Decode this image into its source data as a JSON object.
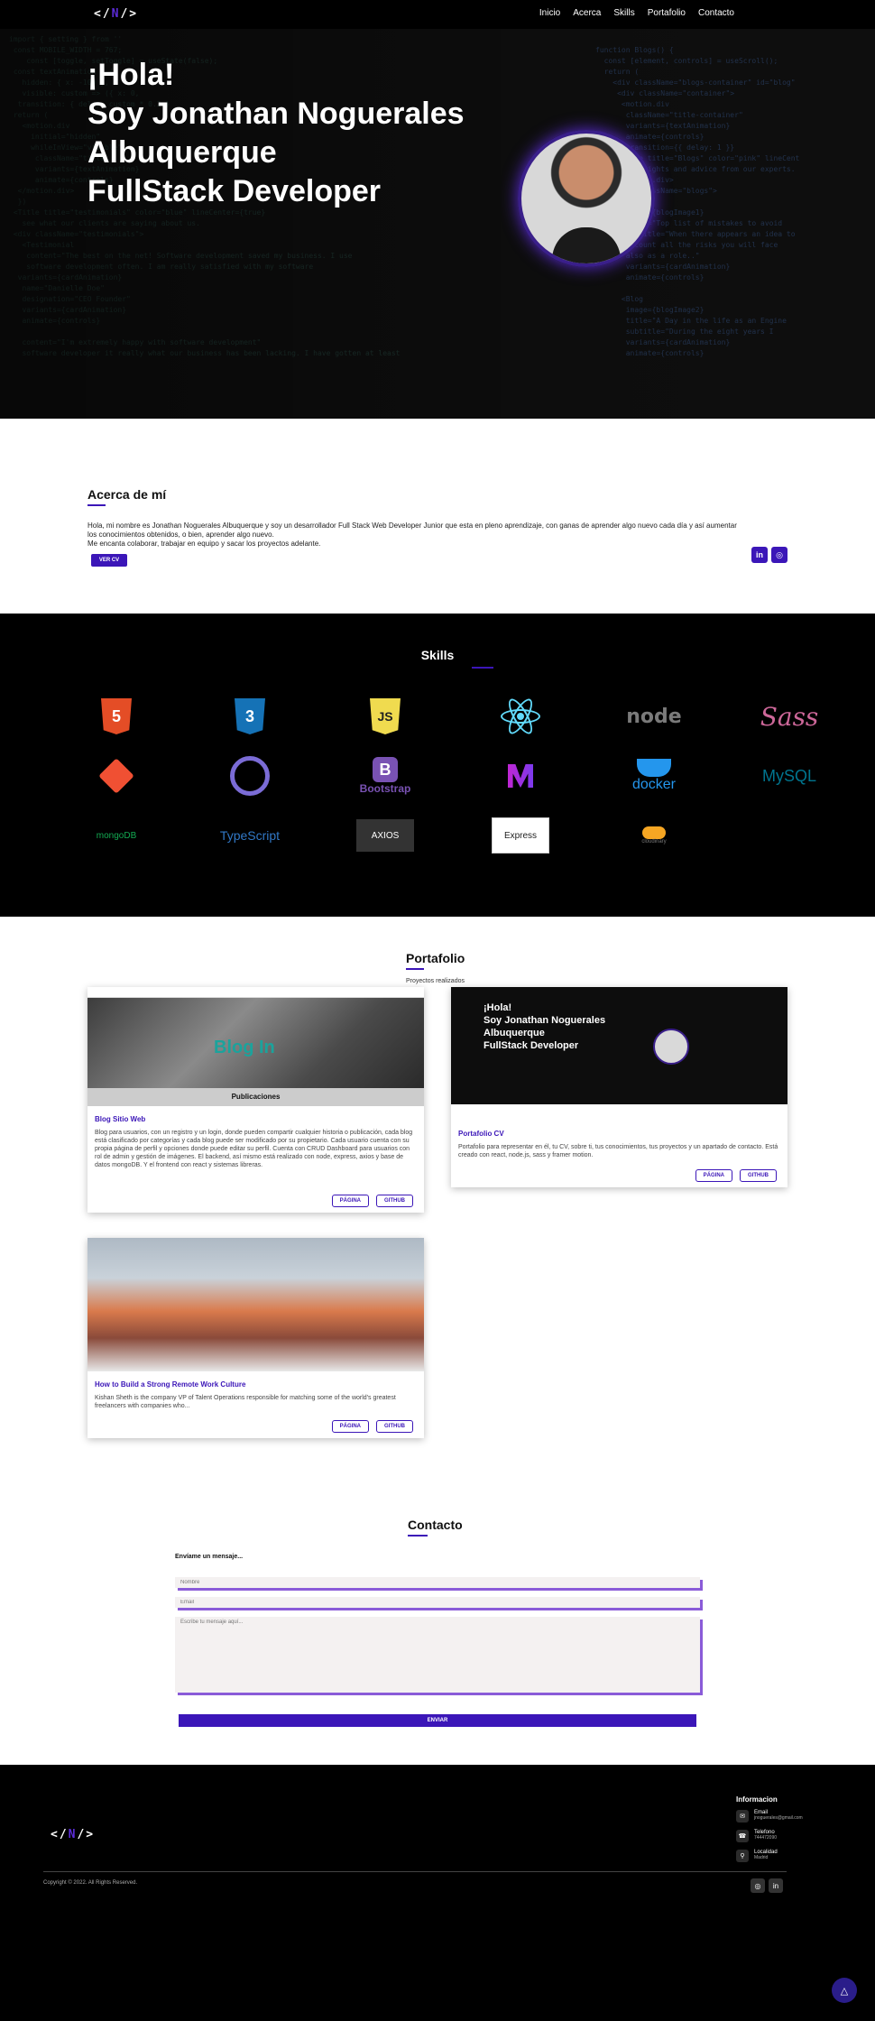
{
  "nav": {
    "logo": "</>",
    "links": [
      "Inicio",
      "Acerca",
      "Skills",
      "Portafolio",
      "Contacto"
    ]
  },
  "hero": {
    "lines": [
      "¡Hola!",
      "Soy Jonathan Noguerales",
      "Albuquerque",
      "FullStack Developer"
    ]
  },
  "about": {
    "title": "Acerca de mí",
    "text1": "Hola, mi nombre es Jonathan Noguerales Albuquerque y soy un desarrollador Full Stack Web Developer Junior que esta en pleno aprendizaje, con ganas de aprender algo nuevo cada día y así aumentar los conocimientos obtenidos, o bien, aprender algo nuevo.",
    "text2": "Me encanta colaborar, trabajar en equipo y sacar los proyectos adelante.",
    "cv_label": "VER CV"
  },
  "skills": {
    "title": "Skills",
    "items": [
      {
        "name": "HTML5",
        "label": "5"
      },
      {
        "name": "CSS3",
        "label": "3"
      },
      {
        "name": "JavaScript",
        "label": "JS"
      },
      {
        "name": "React",
        "label": ""
      },
      {
        "name": "Node",
        "label": "node"
      },
      {
        "name": "Sass",
        "label": "Sass"
      },
      {
        "name": "Git",
        "label": ""
      },
      {
        "name": "GitHub",
        "label": ""
      },
      {
        "name": "Bootstrap",
        "label": "Bootstrap"
      },
      {
        "name": "Vite",
        "label": ""
      },
      {
        "name": "Docker",
        "label": "docker"
      },
      {
        "name": "MySQL",
        "label": "MySQL"
      },
      {
        "name": "MongoDB",
        "label": "mongoDB"
      },
      {
        "name": "TypeScript",
        "label": "TypeScript"
      },
      {
        "name": "Axios",
        "label": "AXIOS"
      },
      {
        "name": "Express",
        "label": "Express"
      },
      {
        "name": "Cloudinary",
        "label": "cloudinary"
      }
    ]
  },
  "portfolio": {
    "title": "Portafolio",
    "subtitle": "Proyectos realizados",
    "cards": [
      {
        "title": "Blog Sitio Web",
        "desc": "Blog para usuarios, con un registro y un login, donde pueden compartir cualquier historia o publicación, cada blog está clasificado por categorías y cada blog puede ser modificado por su propietario. Cada usuario cuenta con su propia página de perfil y opciones donde puede editar su perfil. Cuenta con CRUD Dashboard para usuarios con rol de admin y gestión de imágenes. El backend, así mismo está realizado con node, express, axios y base de datos mongoDB. Y el frontend con react y sistemas libreras.",
        "img_title": "Blog In",
        "img_caption": "Publicaciones"
      },
      {
        "title": "Portafolio CV",
        "desc": "Portafolio para representar en él, tu CV, sobre ti, tus conocimientos, tus proyectos y un apartado de contacto. Está creado con react, node.js, sass y framer motion."
      },
      {
        "title": "How to Build a Strong Remote Work Culture",
        "desc": "Kishan Sheth is the company VP of Talent Operations responsible for matching some of the world's greatest freelancers with companies who..."
      }
    ],
    "btn_page": "PÁGINA",
    "btn_github": "GITHUB"
  },
  "contact": {
    "title": "Contacto",
    "label": "Envíame un mensaje...",
    "name_ph": "Nombre",
    "email_ph": "Email",
    "msg_ph": "Escribe tu mensaje aquí...",
    "send": "ENVIAR"
  },
  "footer": {
    "logo": "</>",
    "info_title": "Informacion",
    "email_label": "Email",
    "email_value": "jnoguerales@gmail.com",
    "phone_label": "Telefono",
    "phone_value": "744472090",
    "loc_label": "Localidad",
    "loc_value": "Madrid",
    "copyright": "Copyright © 2022. All Rights Reserved."
  },
  "colors": {
    "accent": "#3b16b8",
    "accent_light": "#5b2bd6"
  }
}
